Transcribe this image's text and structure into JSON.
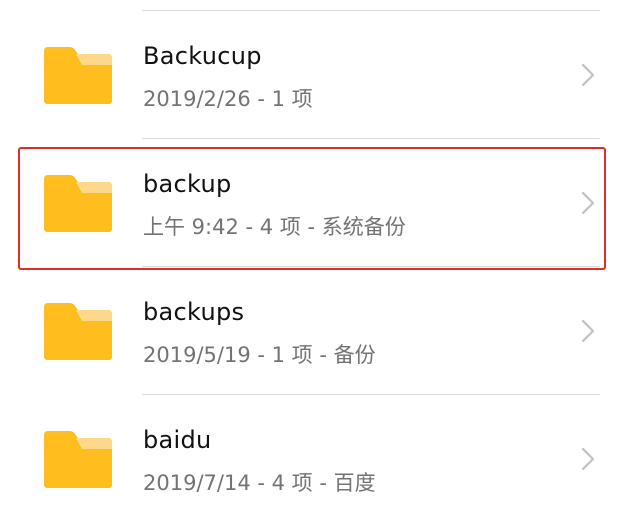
{
  "colors": {
    "folder_body": "#FFBE1E",
    "folder_tab": "#FFD98A",
    "highlight_border": "#E02B2B",
    "chevron": "#C2C2C2",
    "divider": "#DCDCDC"
  },
  "folders": [
    {
      "name": "Backucup",
      "meta": "2019/2/26 - 1 项",
      "icon": "folder-icon",
      "selected": false
    },
    {
      "name": "backup",
      "meta": "上午 9:42 - 4 项 - 系统备份",
      "icon": "folder-icon",
      "selected": true
    },
    {
      "name": "backups",
      "meta": "2019/5/19 - 1 项 - 备份",
      "icon": "folder-icon",
      "selected": false
    },
    {
      "name": "baidu",
      "meta": "2019/7/14 - 4 项 - 百度",
      "icon": "folder-icon",
      "selected": false
    }
  ]
}
